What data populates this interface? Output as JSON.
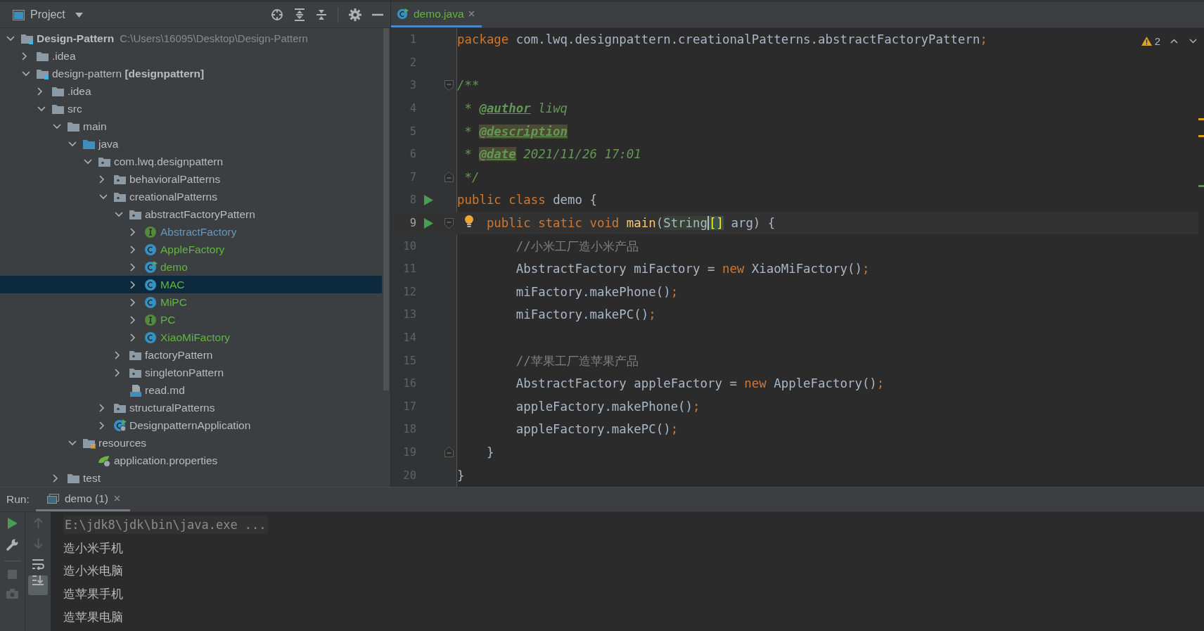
{
  "project_panel": {
    "title": "Project",
    "tree": [
      {
        "label": "Design-Pattern",
        "hint": "C:\\Users\\16095\\Desktop\\Design-Pattern",
        "kind": "module",
        "expanded": true,
        "selected": false,
        "children": [
          {
            "label": ".idea",
            "kind": "folder",
            "expanded": false,
            "selected": false
          },
          {
            "label": "design-pattern **[designpattern]**",
            "kind": "module",
            "expanded": true,
            "selected": false,
            "children": [
              {
                "label": ".idea",
                "kind": "folder",
                "expanded": false,
                "selected": false
              },
              {
                "label": "src",
                "kind": "folder",
                "expanded": true,
                "selected": false,
                "children": [
                  {
                    "label": "main",
                    "kind": "folder",
                    "expanded": true,
                    "selected": false,
                    "children": [
                      {
                        "label": "java",
                        "kind": "source-folder",
                        "expanded": true,
                        "selected": false,
                        "children": [
                          {
                            "label": "com.lwq.designpattern",
                            "kind": "package",
                            "expanded": true,
                            "selected": false,
                            "children": [
                              {
                                "label": "behavioralPatterns",
                                "kind": "package",
                                "expanded": false,
                                "selected": false
                              },
                              {
                                "label": "creationalPatterns",
                                "kind": "package",
                                "expanded": true,
                                "selected": false,
                                "children": [
                                  {
                                    "label": "abstractFactoryPattern",
                                    "kind": "package",
                                    "expanded": true,
                                    "selected": false,
                                    "children": [
                                      {
                                        "label": "AbstractFactory",
                                        "kind": "interface",
                                        "color": "#6897bb",
                                        "expanded": false,
                                        "selected": false
                                      },
                                      {
                                        "label": "AppleFactory",
                                        "kind": "class",
                                        "color": "#62b543",
                                        "expanded": false,
                                        "selected": false
                                      },
                                      {
                                        "label": "demo",
                                        "kind": "class-run",
                                        "color": "#62b543",
                                        "expanded": false,
                                        "selected": false
                                      },
                                      {
                                        "label": "MAC",
                                        "kind": "class",
                                        "color": "#62b543",
                                        "expanded": false,
                                        "selected": true
                                      },
                                      {
                                        "label": "MiPC",
                                        "kind": "class",
                                        "color": "#62b543",
                                        "expanded": false,
                                        "selected": false
                                      },
                                      {
                                        "label": "PC",
                                        "kind": "interface",
                                        "color": "#62b543",
                                        "expanded": false,
                                        "selected": false
                                      },
                                      {
                                        "label": "XiaoMiFactory",
                                        "kind": "class",
                                        "color": "#62b543",
                                        "expanded": false,
                                        "selected": false
                                      }
                                    ]
                                  },
                                  {
                                    "label": "factoryPattern",
                                    "kind": "package",
                                    "expanded": false,
                                    "selected": false
                                  },
                                  {
                                    "label": "singletonPattern",
                                    "kind": "package",
                                    "expanded": false,
                                    "selected": false
                                  },
                                  {
                                    "label": "read.md",
                                    "kind": "markdown",
                                    "selected": false
                                  }
                                ]
                              },
                              {
                                "label": "structuralPatterns",
                                "kind": "package",
                                "expanded": false,
                                "selected": false
                              },
                              {
                                "label": "DesignpatternApplication",
                                "kind": "spring-app",
                                "expanded": false,
                                "selected": false
                              }
                            ]
                          }
                        ]
                      },
                      {
                        "label": "resources",
                        "kind": "resources",
                        "expanded": true,
                        "selected": false,
                        "children": [
                          {
                            "label": "application.properties",
                            "kind": "properties",
                            "selected": false
                          }
                        ]
                      }
                    ]
                  },
                  {
                    "label": "test",
                    "kind": "folder",
                    "expanded": false,
                    "selected": false
                  }
                ]
              }
            ]
          }
        ]
      }
    ]
  },
  "editor": {
    "tabs": [
      {
        "label": "demo.java",
        "kind": "class-run",
        "selected": true
      }
    ],
    "warnings": "2",
    "lines": [
      {
        "number": "1",
        "current": false,
        "tokens": [
          {
            "kind": "kw",
            "text": "package"
          },
          {
            "kind": "plain",
            "text": " com.lwq.designpattern.creationalPatterns.abstractFactoryPattern"
          },
          {
            "kind": "semi",
            "text": ";"
          }
        ]
      },
      {
        "number": "2",
        "current": false
      },
      {
        "number": "3",
        "current": false,
        "fold_start": true,
        "tokens": [
          {
            "kind": "doc",
            "text": "/**"
          }
        ]
      },
      {
        "number": "4",
        "current": false,
        "tokens": [
          {
            "kind": "doc",
            "text": " * "
          },
          {
            "kind": "doctag",
            "text": "@author"
          },
          {
            "kind": "doc",
            "text": " liwq"
          }
        ]
      },
      {
        "number": "5",
        "current": false,
        "tokens": [
          {
            "kind": "doc",
            "text": " * "
          },
          {
            "kind": "doctag-hl",
            "text": "@description"
          }
        ]
      },
      {
        "number": "6",
        "current": false,
        "tokens": [
          {
            "kind": "doc",
            "text": " * "
          },
          {
            "kind": "doctag-hl",
            "text": "@date"
          },
          {
            "kind": "doc",
            "text": " 2021/11/26 17:01"
          }
        ]
      },
      {
        "number": "7",
        "current": false,
        "fold_end": true,
        "tokens": [
          {
            "kind": "doc",
            "text": " */"
          }
        ]
      },
      {
        "number": "8",
        "current": false,
        "run": true,
        "tokens": [
          {
            "kind": "kw",
            "text": "public class "
          },
          {
            "kind": "plain",
            "text": "demo {"
          }
        ]
      },
      {
        "number": "9",
        "current": true,
        "run": true,
        "fold_start": true,
        "bulb": true,
        "tokens": [
          {
            "kind": "kw",
            "text": "    public static void "
          },
          {
            "kind": "method",
            "text": "main"
          },
          {
            "kind": "plain",
            "text": "("
          },
          {
            "kind": "ref-hl",
            "text": "String"
          },
          {
            "kind": "brace",
            "text": "[]"
          },
          {
            "kind": "plain",
            "text": " arg) {"
          }
        ]
      },
      {
        "number": "10",
        "current": false,
        "tokens": [
          {
            "kind": "comment",
            "text": "        //小米工厂造小米产品"
          }
        ]
      },
      {
        "number": "11",
        "current": false,
        "tokens": [
          {
            "kind": "plain",
            "text": "        AbstractFactory miFactory = "
          },
          {
            "kind": "kw",
            "text": "new"
          },
          {
            "kind": "plain",
            "text": " XiaoMiFactory()"
          },
          {
            "kind": "semi",
            "text": ";"
          }
        ]
      },
      {
        "number": "12",
        "current": false,
        "tokens": [
          {
            "kind": "plain",
            "text": "        miFactory.makePhone()"
          },
          {
            "kind": "semi",
            "text": ";"
          }
        ]
      },
      {
        "number": "13",
        "current": false,
        "tokens": [
          {
            "kind": "plain",
            "text": "        miFactory.makePC()"
          },
          {
            "kind": "semi",
            "text": ";"
          }
        ]
      },
      {
        "number": "14",
        "current": false
      },
      {
        "number": "15",
        "current": false,
        "tokens": [
          {
            "kind": "comment",
            "text": "        //苹果工厂造苹果产品"
          }
        ]
      },
      {
        "number": "16",
        "current": false,
        "tokens": [
          {
            "kind": "plain",
            "text": "        AbstractFactory appleFactory = "
          },
          {
            "kind": "kw",
            "text": "new"
          },
          {
            "kind": "plain",
            "text": " AppleFactory()"
          },
          {
            "kind": "semi",
            "text": ";"
          }
        ]
      },
      {
        "number": "17",
        "current": false,
        "tokens": [
          {
            "kind": "plain",
            "text": "        appleFactory.makePhone()"
          },
          {
            "kind": "semi",
            "text": ";"
          }
        ]
      },
      {
        "number": "18",
        "current": false,
        "tokens": [
          {
            "kind": "plain",
            "text": "        appleFactory.makePC()"
          },
          {
            "kind": "semi",
            "text": ";"
          }
        ]
      },
      {
        "number": "19",
        "current": false,
        "fold_end": true,
        "tokens": [
          {
            "kind": "plain",
            "text": "    }"
          }
        ]
      },
      {
        "number": "20",
        "current": false,
        "tokens": [
          {
            "kind": "plain",
            "text": "}"
          }
        ]
      }
    ]
  },
  "run_panel": {
    "label": "Run:",
    "tabs": [
      {
        "label": "demo (1)",
        "selected": true
      }
    ],
    "autoscroll": true,
    "console": [
      {
        "kind": "command",
        "text": "E:\\jdk8\\jdk\\bin\\java.exe ..."
      },
      {
        "kind": "output",
        "text": "造小米手机"
      },
      {
        "kind": "output",
        "text": "造小米电脑"
      },
      {
        "kind": "output",
        "text": "造苹果手机"
      },
      {
        "kind": "output",
        "text": "造苹果电脑"
      }
    ]
  }
}
